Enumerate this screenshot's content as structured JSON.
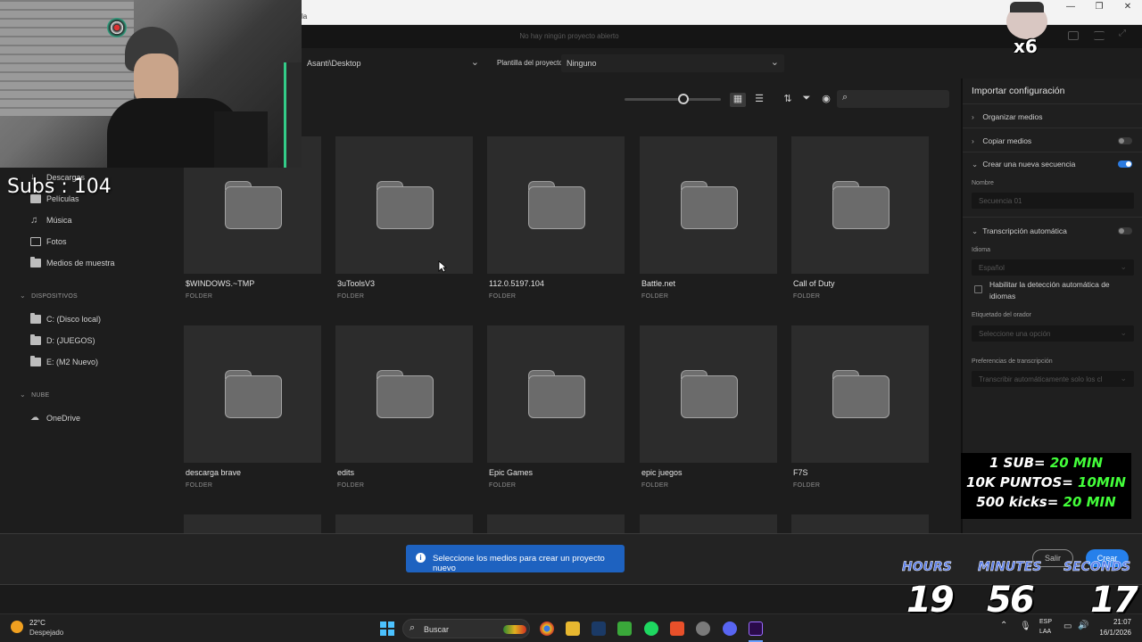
{
  "window": {
    "tab_label": "la",
    "title": "No hay ningún proyecto abierto"
  },
  "location": {
    "path": "Asanti\\Desktop",
    "template_label": "Plantilla del proyecto",
    "template_value": "Ninguno"
  },
  "sidebar": {
    "items_top": [
      {
        "label": "Descargas",
        "icon": "download-icon"
      },
      {
        "label": "Películas",
        "icon": "film-icon"
      },
      {
        "label": "Música",
        "icon": "music-icon"
      },
      {
        "label": "Fotos",
        "icon": "image-icon"
      },
      {
        "label": "Medios de muestra",
        "icon": "folder-icon"
      }
    ],
    "devices_heading": "DISPOSITIVOS",
    "devices": [
      {
        "label": "C: (Disco local)"
      },
      {
        "label": "D: (JUEGOS)"
      },
      {
        "label": "E: (M2 Nuevo)"
      }
    ],
    "cloud_heading": "NUBE",
    "cloud": [
      {
        "label": "OneDrive"
      }
    ]
  },
  "media": {
    "items": [
      {
        "name": "$WINDOWS.~TMP",
        "type": "FOLDER"
      },
      {
        "name": "3uToolsV3",
        "type": "FOLDER"
      },
      {
        "name": "112.0.5197.104",
        "type": "FOLDER"
      },
      {
        "name": "Battle.net",
        "type": "FOLDER"
      },
      {
        "name": "Call of Duty",
        "type": "FOLDER"
      },
      {
        "name": "descarga brave",
        "type": "FOLDER"
      },
      {
        "name": "edits",
        "type": "FOLDER"
      },
      {
        "name": "Epic Games",
        "type": "FOLDER"
      },
      {
        "name": "epic juegos",
        "type": "FOLDER"
      },
      {
        "name": "F7S",
        "type": "FOLDER"
      }
    ]
  },
  "import": {
    "title": "Importar configuración",
    "organize": "Organizar medios",
    "copy": "Copiar medios",
    "copy_enabled": false,
    "new_sequence": "Crear una nueva secuencia",
    "new_sequence_enabled": true,
    "name_label": "Nombre",
    "name_placeholder": "Secuencia 01",
    "transcription": "Transcripción automática",
    "transcription_enabled": false,
    "language_label": "Idioma",
    "language_value": "Español",
    "auto_detect": "Habilitar la detección automática de idiomas",
    "speaker_label": "Etiquetado del orador",
    "speaker_value": "Seleccione una opción",
    "prefs_label": "Preferencias de transcripción",
    "prefs_value": "Transcribir automáticamente solo los cl"
  },
  "footer": {
    "notice": "Seleccione los medios para crear un proyecto nuevo",
    "exit_label": "Salir",
    "create_label": "Crear"
  },
  "taskbar": {
    "weather_temp": "22°C",
    "weather_desc": "Despejado",
    "search_label": "Buscar",
    "lang_1": "ESP",
    "lang_2": "LAA",
    "time": "21:07",
    "date": "16/1/2026"
  },
  "stream": {
    "subs_text": "Subs : 104",
    "sticker_text": "x6",
    "rules": [
      {
        "left": "1 SUB= ",
        "right": "20 MIN"
      },
      {
        "left": "10K PUNTOS= ",
        "right": "10MIN"
      },
      {
        "left": "500 kicks= ",
        "right": "20 MIN"
      }
    ],
    "hours_label": "HOURS",
    "minutes_label": "MINUTES",
    "seconds_label": "SECONDS",
    "hours": "19",
    "minutes": "56",
    "seconds": "17"
  },
  "colors": {
    "accent": "#2680eb",
    "notice_bg": "#1e62c0",
    "promo_green": "#43ff3a"
  }
}
